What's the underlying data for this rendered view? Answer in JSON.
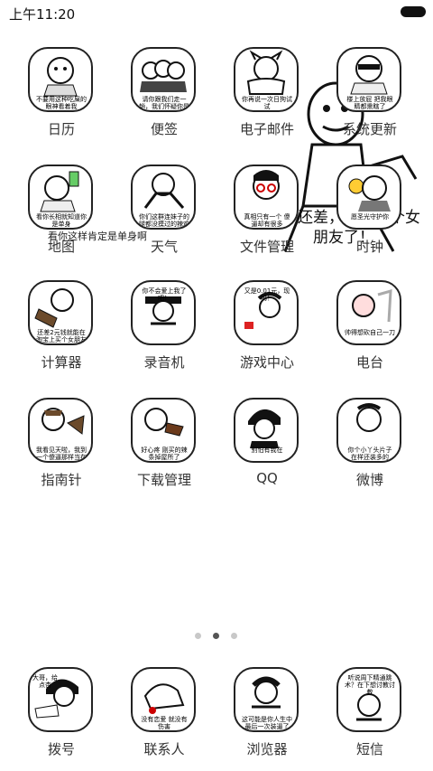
{
  "status_bar": {
    "time": "上午11:20"
  },
  "wallpaper": {
    "caption_right": "就，还差，自能买个女朋友了！",
    "caption_left": "看你这样肯定是单身啊"
  },
  "apps": [
    {
      "label": "日历",
      "caption": "不要用这种吃屎的眼神看着我"
    },
    {
      "label": "便签",
      "caption": "请你跟我们走一趟，我们怀疑你是单身"
    },
    {
      "label": "电子邮件",
      "caption": "你再说一次日狗试试"
    },
    {
      "label": "系统更新",
      "caption": "楼上放屁 把我眼睛都熏瞎了"
    },
    {
      "label": "地图",
      "caption": "看你长相就知道你是单身"
    },
    {
      "label": "天气",
      "caption": "你们这群连妹子的腿都没摸过的辣鸡"
    },
    {
      "label": "文件管理",
      "caption": "真相只有一个 傻逼却有很多"
    },
    {
      "label": "时钟",
      "caption": "愿圣光守护你"
    },
    {
      "label": "计算器",
      "caption": "还差2元钱就能在淘宝上买个女朋友了"
    },
    {
      "label": "录音机",
      "caption": "你不会爱上我了吧！"
    },
    {
      "label": "游戏中心",
      "caption": "又是0.01元，现吗！"
    },
    {
      "label": "电台",
      "caption": "帅得想砍自己一刀"
    },
    {
      "label": "指南针",
      "caption": "我看见天啦，我到一个傻逼那样当在你面前看我下真是不幸"
    },
    {
      "label": "下载管理",
      "caption": "好心疼 刚买的辣条掉屋所了"
    },
    {
      "label": "QQ",
      "caption": "别怕有我在"
    },
    {
      "label": "微博",
      "caption": "你个小丫头片子 在样还装多的"
    }
  ],
  "dock": [
    {
      "label": "拨号",
      "caption": "大哥，给点杏"
    },
    {
      "label": "联系人",
      "caption": "没有恋爱 就没有伤害"
    },
    {
      "label": "浏览器",
      "caption": "这可能是你人生中最后一次装逼了"
    },
    {
      "label": "短信",
      "caption": "听说周下精通跳术？在下想讨教讨教"
    }
  ],
  "page_indicator": {
    "pages": 3,
    "current": 2
  }
}
